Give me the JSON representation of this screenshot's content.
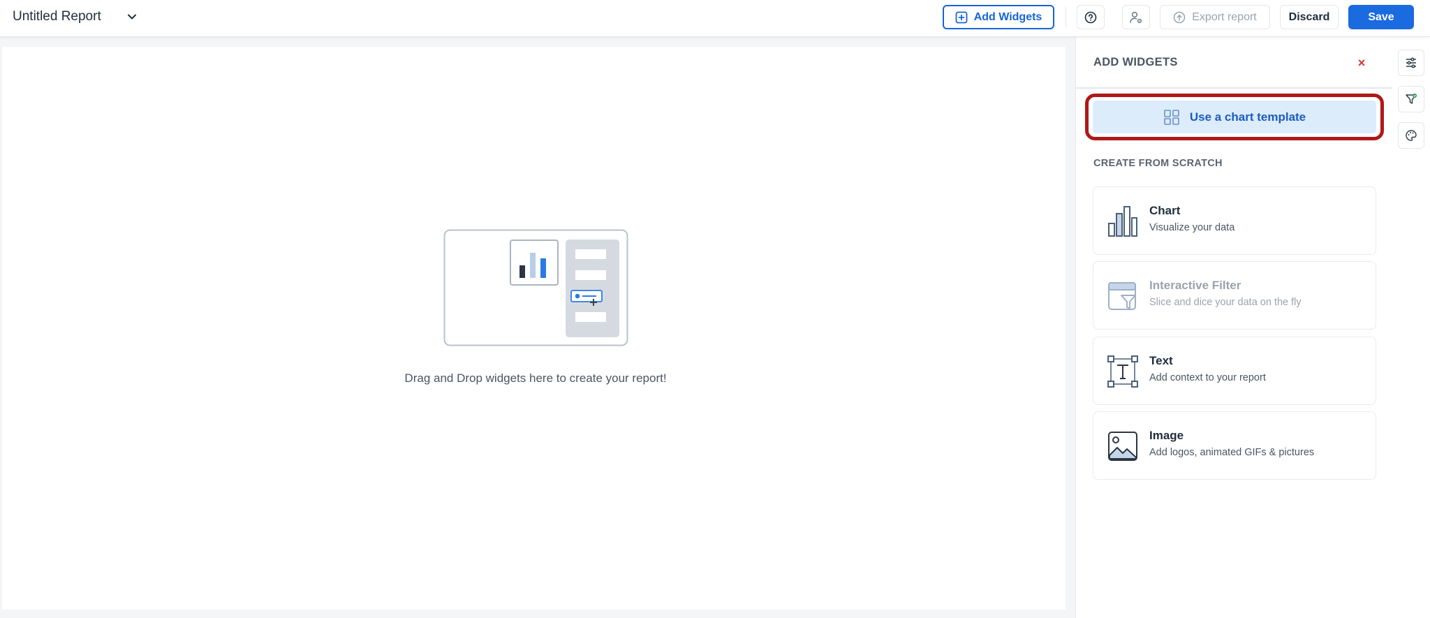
{
  "header": {
    "report_title": "Untitled Report",
    "add_widgets_label": "Add Widgets",
    "export_label": "Export report",
    "discard_label": "Discard",
    "save_label": "Save",
    "accent_color": "#1a6ae0"
  },
  "canvas": {
    "empty_message": "Drag and Drop widgets here to create your report!"
  },
  "panel": {
    "title": "ADD WIDGETS",
    "close_glyph": "×",
    "template_label": "Use a chart template",
    "section_label": "CREATE FROM SCRATCH",
    "highlight_color": "#b01818",
    "widgets": [
      {
        "name": "Chart",
        "description": "Visualize your data",
        "icon": "bar-chart-icon",
        "enabled": true
      },
      {
        "name": "Interactive Filter",
        "description": "Slice and dice your data on the fly",
        "icon": "filter-widget-icon",
        "enabled": false
      },
      {
        "name": "Text",
        "description": "Add context to your report",
        "icon": "text-box-icon",
        "enabled": true
      },
      {
        "name": "Image",
        "description": "Add logos, animated GIFs & pictures",
        "icon": "image-icon",
        "enabled": true
      }
    ]
  },
  "rail": {
    "icons": [
      "sliders-icon",
      "filter-check-icon",
      "palette-icon"
    ]
  }
}
